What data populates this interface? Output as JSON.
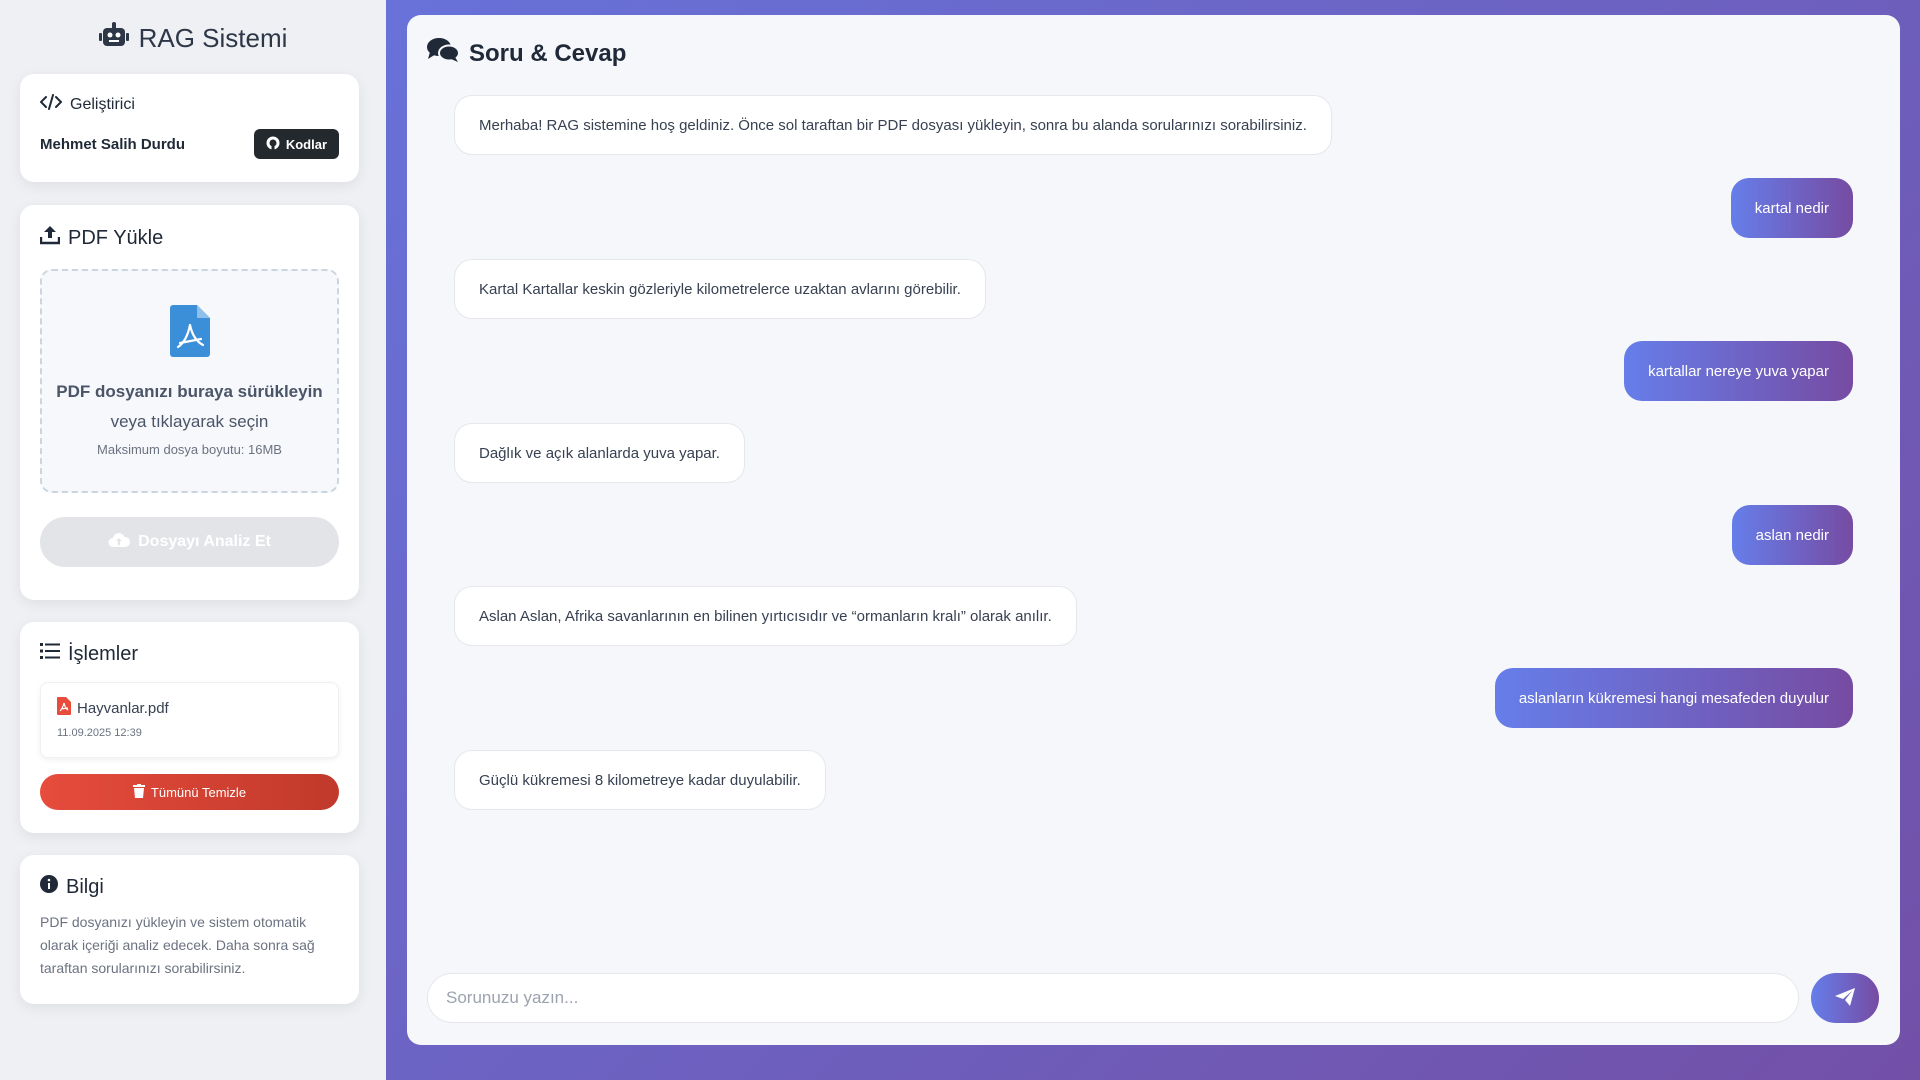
{
  "brand": {
    "title": "RAG Sistemi",
    "icon": "robot-icon"
  },
  "developer": {
    "title": "Geliştirici",
    "name": "Mehmet Salih Durdu",
    "code_button": "Kodlar"
  },
  "upload": {
    "title": "PDF Yükle",
    "drop_main": "PDF dosyanızı buraya sürükleyin",
    "drop_sub": "veya tıklayarak seçin",
    "drop_hint": "Maksimum dosya boyutu: 16MB",
    "analyze_button": "Dosyayı Analiz Et"
  },
  "operations": {
    "title": "İşlemler",
    "files": [
      {
        "name": "Hayvanlar.pdf",
        "date": "11.09.2025 12:39"
      }
    ],
    "clear_button": "Tümünü Temizle"
  },
  "info": {
    "title": "Bilgi",
    "text": "PDF dosyanızı yükleyin ve sistem otomatik olarak içeriği analiz edecek. Daha sonra sağ taraftan sorularınızı sorabilirsiniz."
  },
  "chat": {
    "title": "Soru & Cevap",
    "messages": [
      {
        "role": "bot",
        "text": "Merhaba! RAG sistemine hoş geldiniz. Önce sol taraftan bir PDF dosyası yükleyin, sonra bu alanda sorularınızı sorabilirsiniz."
      },
      {
        "role": "user",
        "text": "kartal nedir"
      },
      {
        "role": "bot",
        "text": "Kartal Kartallar keskin gözleriyle kilometrelerce uzaktan avlarını görebilir."
      },
      {
        "role": "user",
        "text": "kartallar nereye yuva yapar"
      },
      {
        "role": "bot",
        "text": "Dağlık ve açık alanlarda yuva yapar."
      },
      {
        "role": "user",
        "text": "aslan nedir"
      },
      {
        "role": "bot",
        "text": "Aslan Aslan, Afrika savanlarının en bilinen yırtıcısıdır ve “ormanların kralı” olarak anılır."
      },
      {
        "role": "user",
        "text": "aslanların kükremesi hangi mesafeden duyulur"
      },
      {
        "role": "bot",
        "text": "Güçlü kükremesi 8 kilometreye kadar duyulabilir."
      }
    ],
    "input_placeholder": "Sorunuzu yazın...",
    "input_value": ""
  },
  "colors": {
    "accent_start": "#667eea",
    "accent_end": "#764ba2",
    "danger": "#e74c3c",
    "pdf_blue": "#3b8fd9"
  }
}
